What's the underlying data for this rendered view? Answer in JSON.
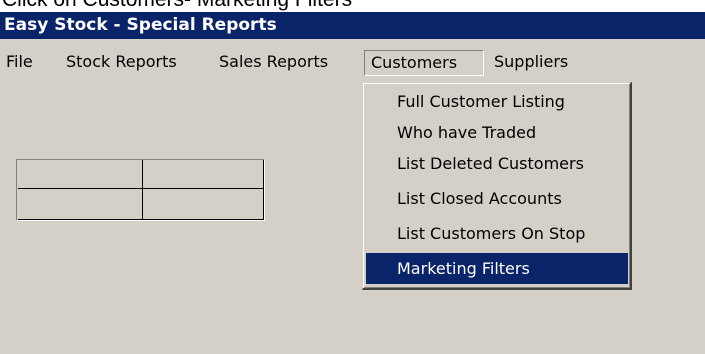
{
  "caption": {
    "text": "Click on Customers- Marketing Filters"
  },
  "window": {
    "title": "Easy Stock - Special Reports"
  },
  "menubar": {
    "items": [
      {
        "label": "File"
      },
      {
        "label": "Stock Reports"
      },
      {
        "label": "Sales Reports"
      },
      {
        "label": "Customers"
      },
      {
        "label": "Suppliers"
      }
    ]
  },
  "customers_menu": {
    "items": [
      {
        "label": "Full Customer Listing"
      },
      {
        "label": "Who have Traded"
      },
      {
        "label": "List Deleted Customers"
      },
      {
        "label": "List Closed Accounts"
      },
      {
        "label": "List Customers On Stop"
      },
      {
        "label": "Marketing Filters"
      }
    ],
    "selected": "Marketing Filters"
  },
  "colors": {
    "titlebar": "#0a246a",
    "highlight": "#0a246a",
    "face": "#d4d0c8"
  }
}
